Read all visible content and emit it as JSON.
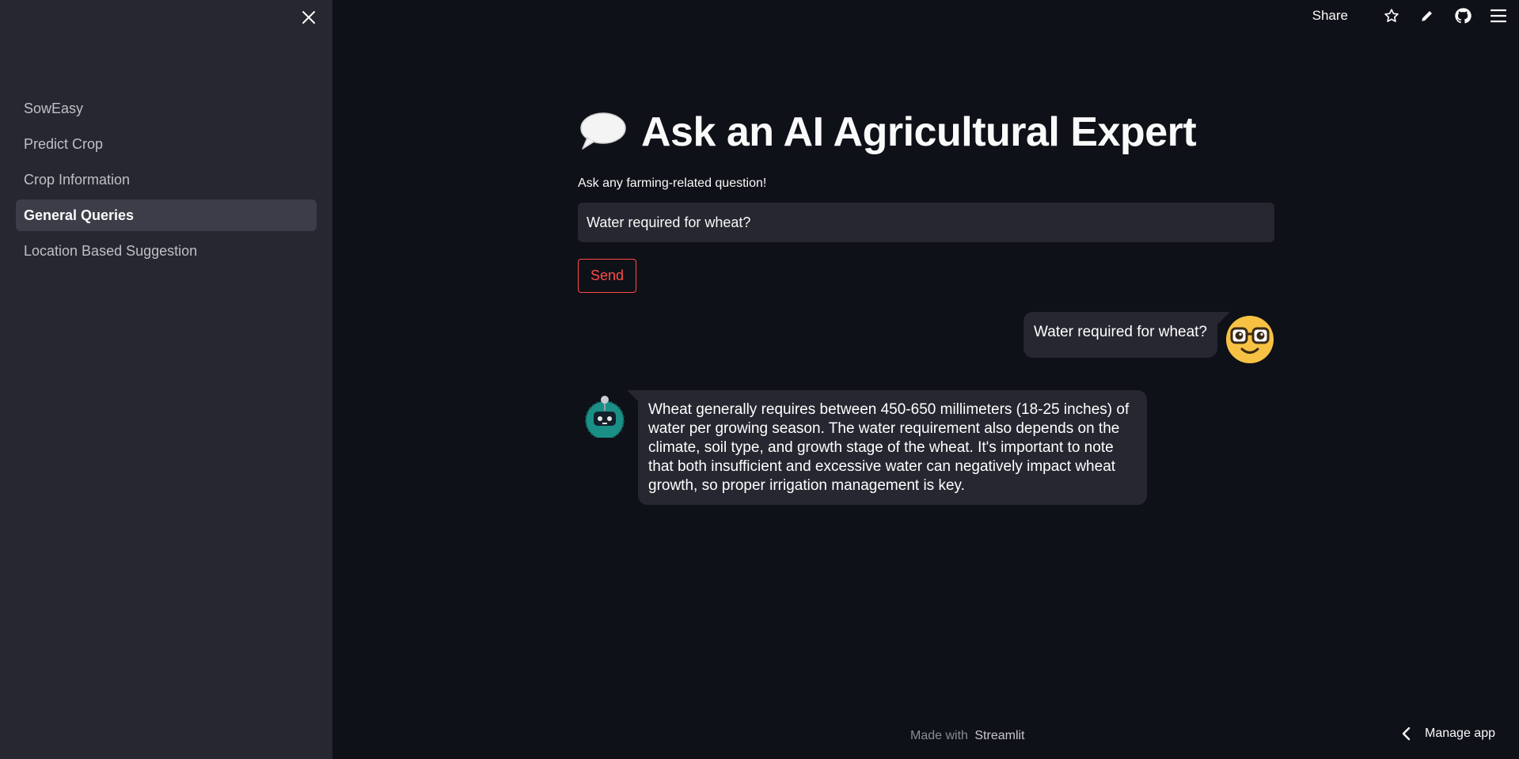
{
  "sidebar": {
    "items": [
      {
        "label": "SowEasy",
        "active": false
      },
      {
        "label": "Predict Crop",
        "active": false
      },
      {
        "label": "Crop Information",
        "active": false
      },
      {
        "label": "General Queries",
        "active": true
      },
      {
        "label": "Location Based Suggestion",
        "active": false
      }
    ],
    "close_icon": "close-icon"
  },
  "toolbar": {
    "share_label": "Share",
    "icons": [
      "star-icon",
      "pencil-icon",
      "github-icon",
      "hamburger-menu-icon"
    ]
  },
  "main": {
    "title": "Ask an AI Agricultural Expert",
    "title_icon": "speech-bubble-icon",
    "question_label": "Ask any farming-related question!",
    "question_value": "Water required for wheat?",
    "send_label": "Send"
  },
  "chat": {
    "user_message": "Water required for wheat?",
    "user_avatar": "nerd-face-avatar-icon",
    "bot_avatar": "robot-avatar-icon",
    "bot_message": "Wheat generally requires between 450-650 millimeters (18-25 inches) of water per growing season. The water requirement also depends on the climate, soil type, and growth stage of the wheat. It's important to note that both insufficient and excessive water can negatively impact wheat growth, so proper irrigation management is key."
  },
  "footer": {
    "made_with": "Made with",
    "brand": "Streamlit",
    "manage_app": "Manage app"
  },
  "colors": {
    "background": "#0e1117",
    "sidebar": "#262730",
    "accent": "#ff4b4b",
    "text": "#fafafa"
  }
}
